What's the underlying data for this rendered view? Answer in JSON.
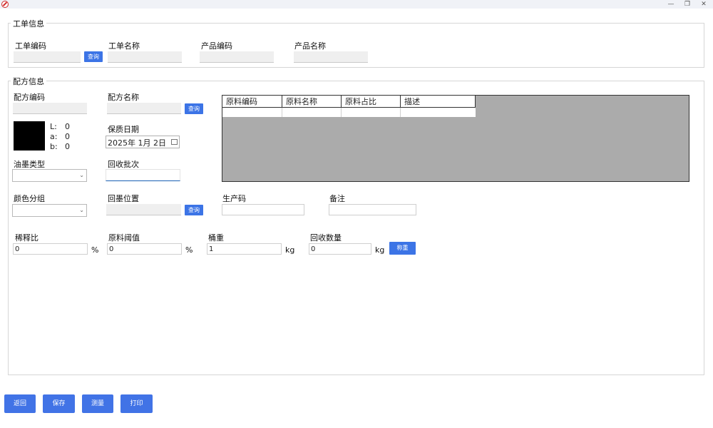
{
  "window": {
    "minimize": "—",
    "restore": "❐",
    "close": "✕"
  },
  "work_order": {
    "legend": "工单信息",
    "code_label": "工单编码",
    "query_label": "查询",
    "name_label": "工单名称",
    "product_code_label": "产品编码",
    "product_name_label": "产品名称"
  },
  "formula": {
    "legend": "配方信息",
    "code_label": "配方编码",
    "name_label": "配方名称",
    "query_label": "查询",
    "lab": {
      "l_key": "L:",
      "l_val": "0",
      "a_key": "a:",
      "a_val": "0",
      "b_key": "b:",
      "b_val": "0"
    },
    "shelf_label": "保质日期",
    "shelf_date": "2025年  1月  2日",
    "ink_type_label": "油墨类型",
    "recycle_batch_label": "回收批次",
    "color_group_label": "颜色分组",
    "recycle_location_label": "回墨位置",
    "location_query_label": "查询",
    "production_code_label": "生产码",
    "remark_label": "备注",
    "dilution_label": "稀释比",
    "dilution_value": "0",
    "dilution_unit": "%",
    "threshold_label": "原料阈值",
    "threshold_value": "0",
    "threshold_unit": "%",
    "bucket_label": "桶重",
    "bucket_value": "1",
    "bucket_unit": "kg",
    "recycle_qty_label": "回收数量",
    "recycle_qty_value": "0",
    "recycle_qty_unit": "kg",
    "weigh_label": "称重",
    "grid_columns": [
      "原料编码",
      "原料名称",
      "原料占比",
      "描述"
    ]
  },
  "footer": {
    "back_label": "返回",
    "save_label": "保存",
    "measure_label": "测量",
    "print_label": "打印"
  },
  "colors": {
    "accent": "#4173e6",
    "grid_bg": "#ababab",
    "swatch": "#000000"
  }
}
